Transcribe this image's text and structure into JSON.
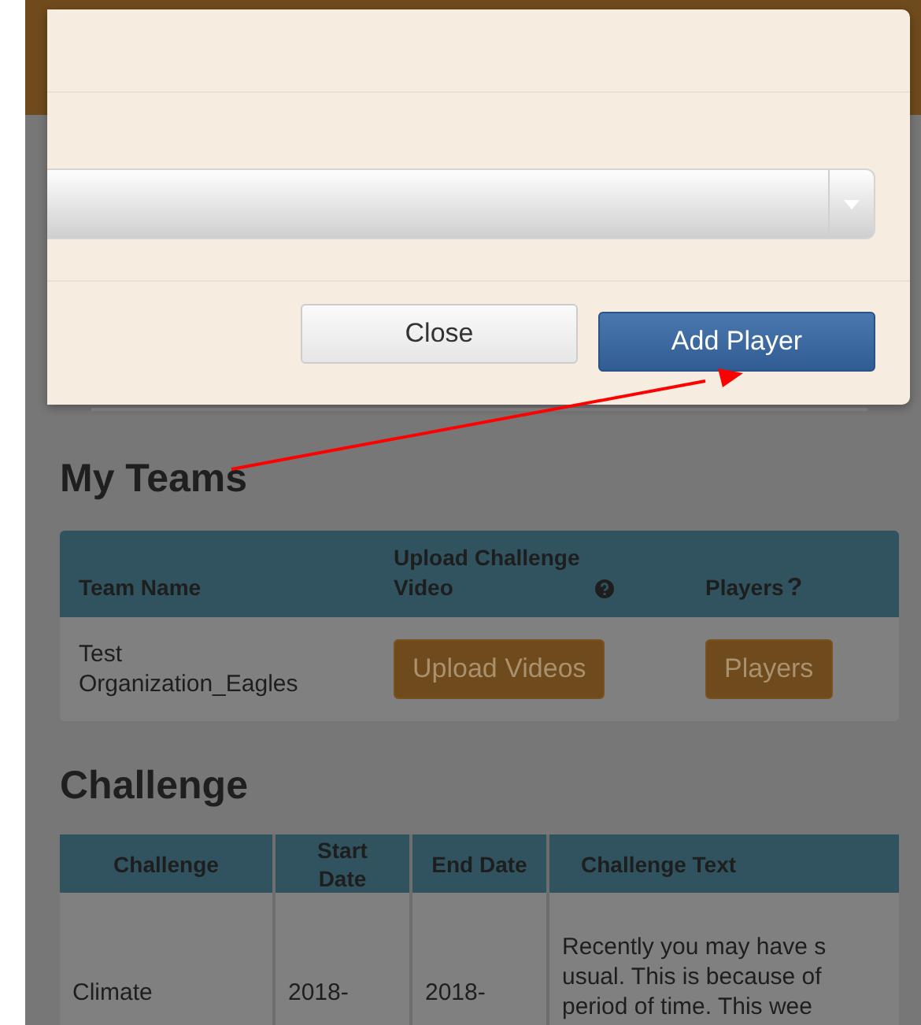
{
  "modal": {
    "buttons": [
      {
        "label": "Close",
        "kind": "default"
      },
      {
        "label": "Add Player",
        "kind": "primary"
      }
    ]
  },
  "my_teams": {
    "title": "My Teams",
    "columns": [
      {
        "label": "Team Name"
      },
      {
        "label": "Upload Challenge Video",
        "help_icon": true
      },
      {
        "label": "Players",
        "suffix": "?"
      }
    ],
    "rows": [
      {
        "team_name": "Test Organization_Eagles",
        "upload_button": "Upload Videos",
        "players_button": "Players"
      }
    ]
  },
  "challenge": {
    "title": "Challenge",
    "columns": [
      "Challenge",
      "Start Date",
      "End Date",
      "Challenge Text"
    ],
    "rows": [
      {
        "challenge": "Climate",
        "start_date": "2018-",
        "end_date": "2018-",
        "text_lines": [
          "Recently you may have s",
          "usual. This is because of",
          "period of time. This wee"
        ]
      }
    ]
  }
}
